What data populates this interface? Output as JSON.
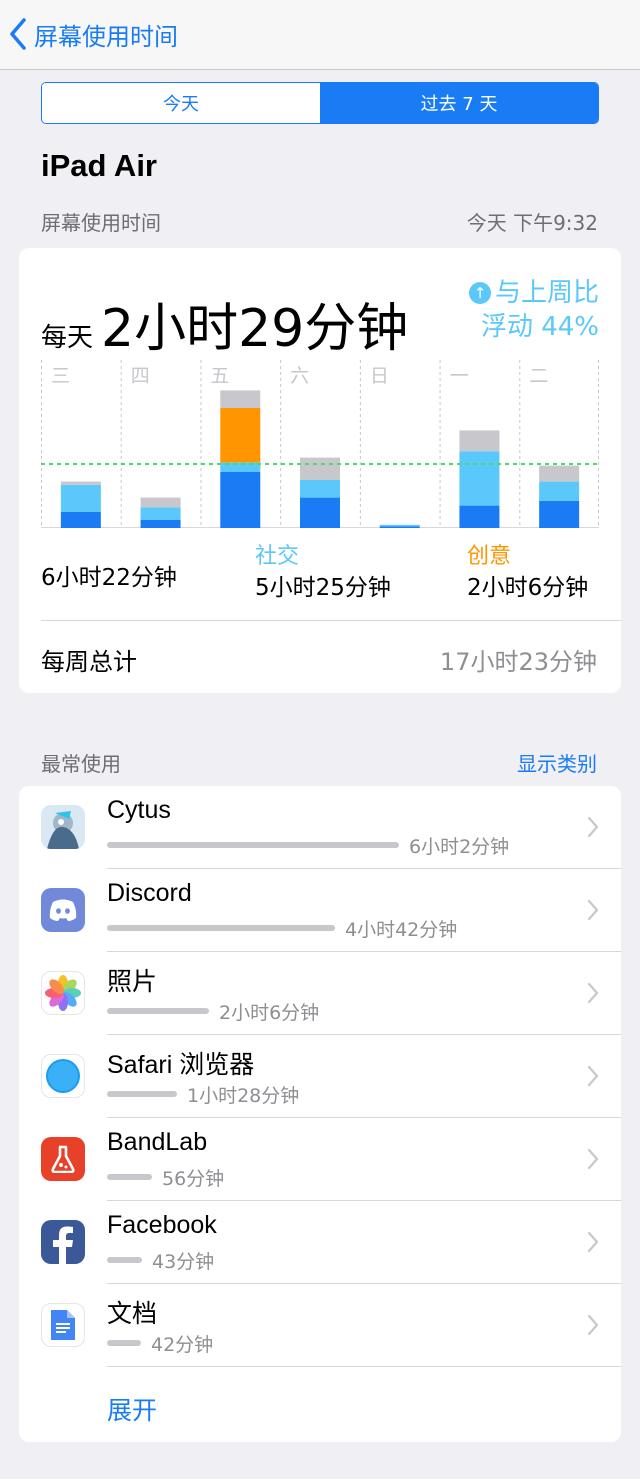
{
  "nav": {
    "back_label": "屏幕使用时间"
  },
  "segments": {
    "today": "今天",
    "last7": "过去 7 天"
  },
  "device_name": "iPad Air",
  "screen_time": {
    "section_label": "屏幕使用时间",
    "timestamp": "今天 下午9:32",
    "avg_prefix": "每天",
    "avg_value": "2小时29分钟",
    "compare_line1": "与上周比",
    "compare_line2": "浮动 44%",
    "compare_icon": "arrow-up-circle-icon",
    "chart_data": {
      "type": "bar",
      "stacked": true,
      "categories": [
        "三",
        "四",
        "五",
        "六",
        "日",
        "一",
        "二"
      ],
      "series": [
        {
          "name": "",
          "color": "#1a7cf5",
          "values": [
            10,
            5,
            35,
            19,
            1,
            14,
            17
          ]
        },
        {
          "name": "社交",
          "color": "#5ac8fa",
          "values": [
            17,
            8,
            6,
            11,
            1,
            34,
            12
          ]
        },
        {
          "name": "创意",
          "color": "#ff9500",
          "values": [
            0,
            0,
            34,
            0,
            0,
            0,
            0
          ]
        },
        {
          "name": "",
          "color": "#c7c7cc",
          "values": [
            2,
            6,
            11,
            14,
            0,
            13,
            10
          ]
        }
      ],
      "average_line": 40,
      "average_line_color": "#4cd964",
      "ymax": 105,
      "grid": true
    },
    "categories": [
      {
        "label": "",
        "value": "6小时22分钟",
        "color": "#000000"
      },
      {
        "label": "社交",
        "value": "5小时25分钟",
        "color": "#5ac8fa"
      },
      {
        "label": "创意",
        "value": "2小时6分钟",
        "color": "#ff9500"
      }
    ],
    "week_total_label": "每周总计",
    "week_total_value": "17小时23分钟"
  },
  "most_used": {
    "section_label": "最常使用",
    "show_categories": "显示类别",
    "apps": [
      {
        "name": "Cytus",
        "time": "6小时2分钟",
        "fraction": 1.0,
        "icon": "cytus-icon"
      },
      {
        "name": "Discord",
        "time": "4小时42分钟",
        "fraction": 0.78,
        "icon": "discord-icon"
      },
      {
        "name": "照片",
        "time": "2小时6分钟",
        "fraction": 0.35,
        "icon": "photos-icon"
      },
      {
        "name": "Safari 浏览器",
        "time": "1小时28分钟",
        "fraction": 0.24,
        "icon": "safari-icon"
      },
      {
        "name": "BandLab",
        "time": "56分钟",
        "fraction": 0.155,
        "icon": "bandlab-icon"
      },
      {
        "name": "Facebook",
        "time": "43分钟",
        "fraction": 0.12,
        "icon": "facebook-icon"
      },
      {
        "name": "文档",
        "time": "42分钟",
        "fraction": 0.115,
        "icon": "docs-icon"
      }
    ],
    "expand_label": "展开"
  }
}
